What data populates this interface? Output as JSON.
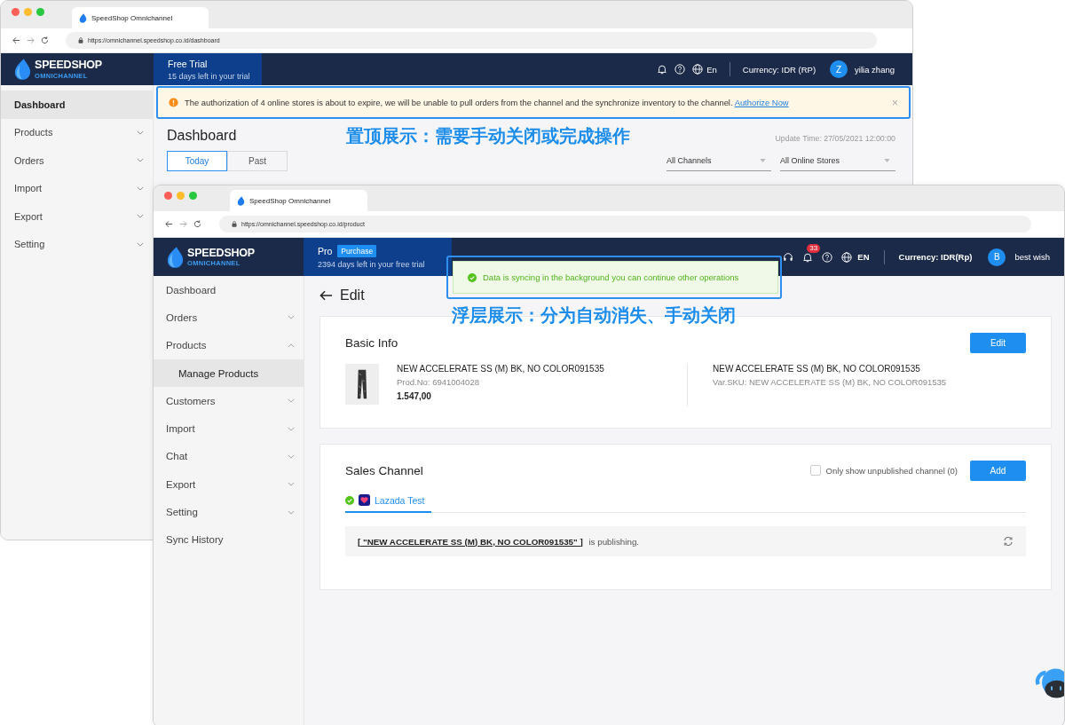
{
  "dashboard_window": {
    "tab_title": "SpeedShop Omnichannel",
    "url": "https://omnichannel.speedshop.co.id/dashboard",
    "logo": {
      "name": "SPEEDSHOP",
      "tagline": "OMNICHANNEL"
    },
    "plan": {
      "name": "Free Trial",
      "note": "15 days left in your trial"
    },
    "header": {
      "language": "En",
      "currency": "Currency: IDR (RP)",
      "avatar": "Z",
      "user": "yilia zhang"
    },
    "sidebar": [
      {
        "kind": "link",
        "label": "Dashboard",
        "selected": true
      },
      {
        "kind": "group",
        "label": "Products",
        "selected": false,
        "expanded": false
      },
      {
        "kind": "group",
        "label": "Orders",
        "selected": false,
        "expanded": false
      },
      {
        "kind": "group",
        "label": "Import",
        "selected": false,
        "expanded": false
      },
      {
        "kind": "group",
        "label": "Export",
        "selected": false,
        "expanded": false
      },
      {
        "kind": "group",
        "label": "Setting",
        "selected": false,
        "expanded": false
      }
    ],
    "banner": {
      "message": "The authorization of 4 online stores is about to expire, we will be unable to pull orders from the channel and the synchronize inventory to the channel.",
      "link": "Authorize Now",
      "close": "×"
    },
    "title": "Dashboard",
    "update_time": "Update Time: 27/05/2021 12:00:00",
    "tabs": [
      {
        "label": "Today",
        "selected": true
      },
      {
        "label": "Past",
        "selected": false
      }
    ],
    "filters": [
      {
        "value": "All Channels"
      },
      {
        "value": "All Online Stores"
      }
    ]
  },
  "edit_window": {
    "tab_title": "SpeedShop Omnichannel",
    "url": "https://omnichannel.speedshop.co.id/product",
    "logo": {
      "name": "SPEEDSHOP",
      "tagline": "OMNICHANNEL"
    },
    "plan": {
      "name": "Pro",
      "badge": "Purchase",
      "note": "2394 days left in your free trial"
    },
    "header": {
      "notifications": "33",
      "language": "EN",
      "currency": "Currency: IDR(Rp)",
      "avatar": "B",
      "user": "best wish"
    },
    "sidebar": [
      {
        "kind": "link",
        "label": "Dashboard",
        "selected": false
      },
      {
        "kind": "group",
        "label": "Orders",
        "selected": false,
        "expanded": false
      },
      {
        "kind": "group",
        "label": "Products",
        "selected": false,
        "expanded": true,
        "children": [
          {
            "label": "Manage Products",
            "selected": true
          }
        ]
      },
      {
        "kind": "group",
        "label": "Customers",
        "selected": false,
        "expanded": false
      },
      {
        "kind": "group",
        "label": "Import",
        "selected": false,
        "expanded": false
      },
      {
        "kind": "group",
        "label": "Chat",
        "selected": false,
        "expanded": false
      },
      {
        "kind": "group",
        "label": "Export",
        "selected": false,
        "expanded": false
      },
      {
        "kind": "group",
        "label": "Setting",
        "selected": false,
        "expanded": false
      },
      {
        "kind": "link",
        "label": "Sync History",
        "selected": false
      }
    ],
    "toast": {
      "message": "Data is syncing in the background you can continue other operations"
    },
    "title": "Edit",
    "basic_info": {
      "title": "Basic Info",
      "button": "Edit",
      "product": {
        "name": "NEW ACCELERATE SS (M) BK, NO COLOR091535",
        "prod_no": "Prod.No: 6941004028",
        "price": "1.547,00"
      },
      "variant": {
        "name": "NEW ACCELERATE SS (M) BK, NO COLOR091535",
        "sku": "Var.SKU: NEW ACCELERATE SS (M) BK, NO COLOR091535"
      }
    },
    "sales_channel": {
      "title": "Sales Channel",
      "filter": {
        "label": "Only show unpublished channel (0)",
        "checked": false
      },
      "button": "Add",
      "tabs": [
        {
          "label": "Lazada Test",
          "selected": true
        }
      ],
      "status": {
        "item": "[ \"NEW ACCELERATE SS (M) BK, NO COLOR091535\" ]",
        "text": " is publishing."
      }
    }
  },
  "annotations": [
    {
      "text": "置顶展示：需要手动关闭或完成操作"
    },
    {
      "text": "浮层展示：分为自动消失、手动关闭"
    }
  ]
}
